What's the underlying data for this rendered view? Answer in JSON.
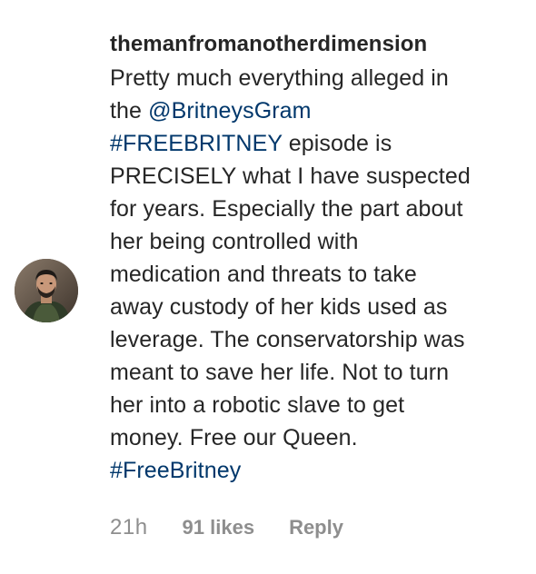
{
  "comment": {
    "username": "themanfromanotherdimension",
    "text_parts": {
      "p1": "Pretty much everything alleged in",
      "p2": "the ",
      "mention": "@BritneysGram",
      "hashtag1": "#FREEBRITNEY",
      "p3": " episode is",
      "p4": "PRECISELY what I have suspected",
      "p5": "for years. Especially the part about",
      "p6": "her being controlled with",
      "p7": "medication and threats to take",
      "p8": "away custody of her kids used as",
      "p9": "leverage. The conservatorship was",
      "p10": "meant to save her life. Not to turn",
      "p11": "her into a robotic slave to get",
      "p12": "money. Free our Queen.",
      "hashtag2": "#FreeBritney"
    },
    "meta": {
      "time": "21h",
      "likes": "91 likes",
      "reply": "Reply"
    }
  },
  "colors": {
    "text": "#262626",
    "link": "#00376b",
    "meta": "#8e8e8e"
  }
}
